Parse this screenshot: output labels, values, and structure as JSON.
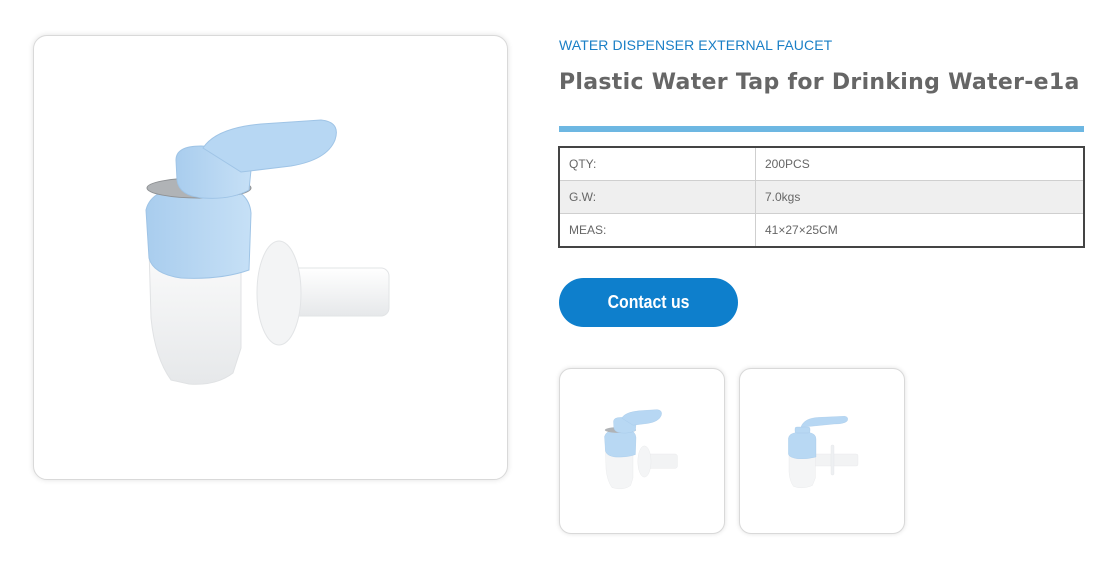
{
  "product": {
    "category": "WATER DISPENSER EXTERNAL FAUCET",
    "title": "Plastic Water Tap for Drinking Water-e1a"
  },
  "specs": [
    {
      "label": "QTY:",
      "value": "200PCS"
    },
    {
      "label": "G.W:",
      "value": "7.0kgs"
    },
    {
      "label": "MEAS:",
      "value": "41×27×25CM"
    }
  ],
  "contact_label": "Contact us",
  "images": {
    "main": "faucet-main-image",
    "thumbnails": [
      "faucet-angle-1-thumbnail",
      "faucet-side-thumbnail"
    ]
  },
  "colors": {
    "accent_blue": "#0e7fcc",
    "category_blue": "#1a7fc6",
    "title_gray": "#666666",
    "title_bar": "#6db7e2",
    "faucet_blue": "#b8d8f3",
    "faucet_white": "#f4f5f6"
  }
}
